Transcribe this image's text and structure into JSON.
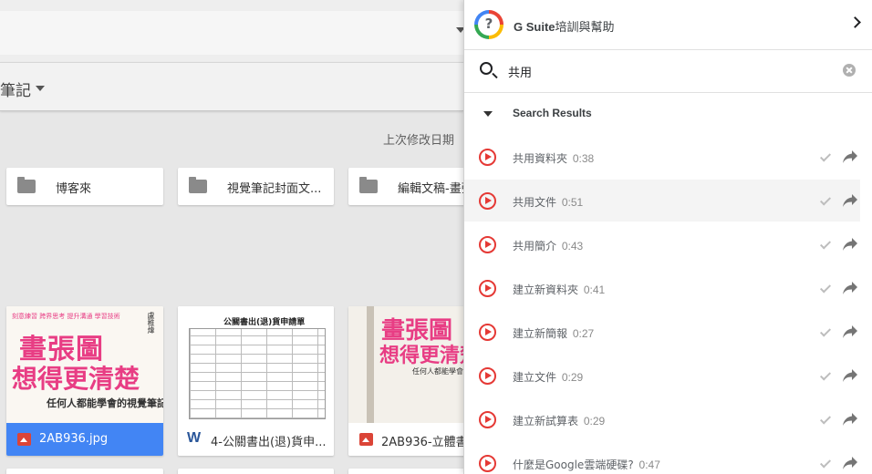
{
  "drive": {
    "breadcrumb": "筆記",
    "sort_label": "上次修改日期",
    "folders": [
      {
        "name": "博客來"
      },
      {
        "name": "視覺筆記封面文..."
      },
      {
        "name": "編輯文稿-畫張"
      }
    ],
    "files": [
      {
        "name": "2AB936.jpg",
        "type": "image",
        "selected": true
      },
      {
        "name": "4-公關書出(退)貨申...",
        "type": "word",
        "selected": false
      },
      {
        "name": "2AB936-立體書",
        "type": "image",
        "selected": false
      }
    ],
    "thumbnails": {
      "cover_title_1": "畫張圖",
      "cover_title_2": "想得更清楚",
      "cover_subtitle": "任何人都能學會的視覺筆記術",
      "cover_tags": "刻意練習 跨界思考 提升溝通 學習技術",
      "cover_author": "盧稚煒",
      "form_title": "公關書出(退)貨申請單"
    }
  },
  "help_panel": {
    "logo_glyph": "?",
    "title_brand": "G Suite",
    "title_rest": "培訓與幫助",
    "search": {
      "value": "共用",
      "placeholder": ""
    },
    "results_label": "Search Results",
    "results": [
      {
        "label": "共用資料夾",
        "duration": "0:38",
        "hover": false
      },
      {
        "label": "共用文件",
        "duration": "0:51",
        "hover": true
      },
      {
        "label": "共用簡介",
        "duration": "0:43",
        "hover": false
      },
      {
        "label": "建立新資料夾",
        "duration": "0:41",
        "hover": false
      },
      {
        "label": "建立新簡報",
        "duration": "0:27",
        "hover": false
      },
      {
        "label": "建立文件",
        "duration": "0:29",
        "hover": false
      },
      {
        "label": "建立新試算表",
        "duration": "0:29",
        "hover": false
      },
      {
        "label": "什麼是Google雲端硬碟?",
        "duration": "0:47",
        "hover": false
      }
    ],
    "colors": {
      "play": "#e53935",
      "check": "#bdbdbd",
      "share": "#757575"
    }
  }
}
